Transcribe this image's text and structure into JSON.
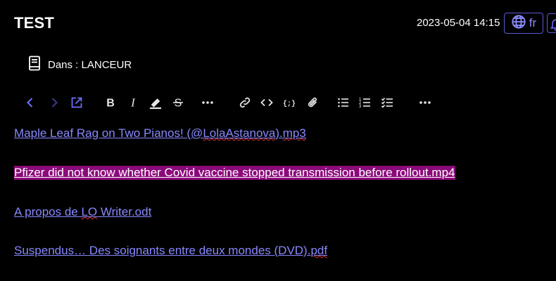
{
  "header": {
    "title": "TEST",
    "datetime": "2023-05-04 14:15",
    "language": "fr"
  },
  "location": {
    "label": "Dans : LANCEUR"
  },
  "toolbar": {
    "items": [
      "back",
      "forward",
      "external-edit",
      "bold",
      "italic",
      "highlight",
      "strikethrough",
      "more-formatting",
      "link",
      "inline-code",
      "code-block",
      "attach",
      "bullet-list",
      "numbered-list",
      "checklist",
      "more"
    ]
  },
  "content": {
    "links": [
      {
        "text": "Maple Leaf Rag on Two Pianos! (@LolaAstanova).mp3",
        "selected": false
      },
      {
        "text": "Pfizer did not know whether Covid vaccine stopped transmission before rollout.mp4",
        "selected": true
      },
      {
        "text": "A propos de LO Writer.odt",
        "selected": false
      },
      {
        "text": "Suspendus… Des soignants entre deux mondes (DVD).pdf",
        "selected": false
      }
    ]
  },
  "colors": {
    "background": "#000000",
    "link": "#8888ff",
    "accent": "#6f6fff",
    "selection": "#8b0a7a"
  }
}
